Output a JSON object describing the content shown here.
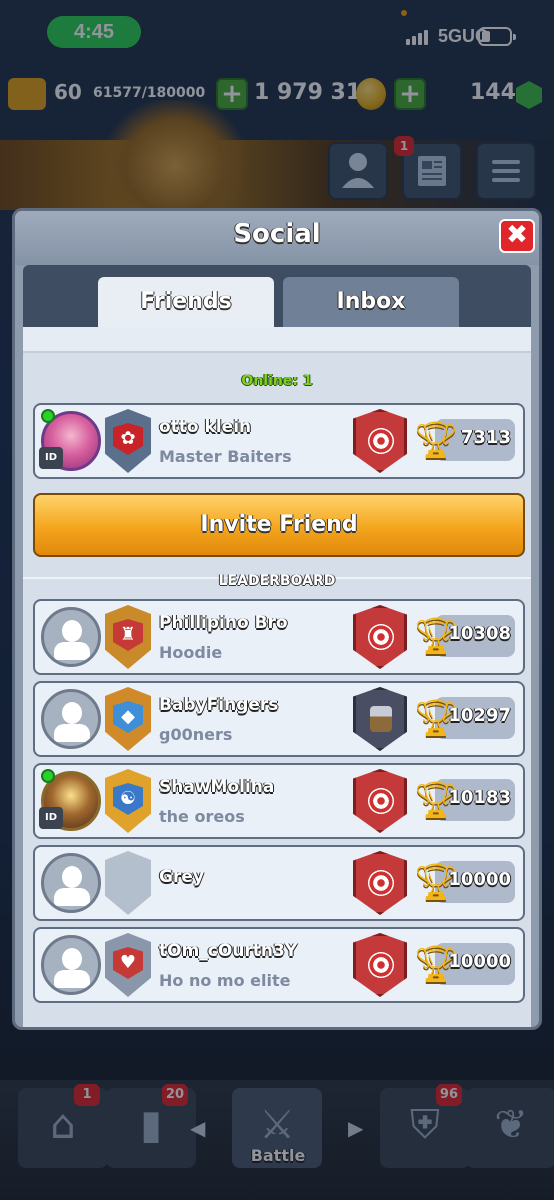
{
  "status_bar": {
    "time": "4:45",
    "network": "5GUC"
  },
  "resources": {
    "level": "60",
    "xp": "61577/180000",
    "gold": "1 979 316",
    "gems": "144",
    "plus": "+"
  },
  "top_buttons": {
    "news_badge": "1"
  },
  "modal": {
    "title": "Social",
    "close_glyph": "✖",
    "tabs": [
      {
        "label": "Friends",
        "selected": true
      },
      {
        "label": "Inbox",
        "selected": false
      }
    ],
    "online_label": "Online: 1",
    "online_friends": [
      {
        "name": "otto klein",
        "clan": "Master Baiters",
        "trophies": "7313",
        "online": true,
        "id_badge": "ID",
        "clan_glyph": "✿",
        "clan_color": "#5a6f8c",
        "clan_inner_color": "#c9232a"
      }
    ],
    "invite_button": "Invite Friend",
    "leaderboard_label": "LEADERBOARD",
    "leaderboard": [
      {
        "name": "Phillipino Bro",
        "clan": "Hoodie",
        "trophies": "10308",
        "online": false,
        "clan_glyph": "♜",
        "clan_color": "#c98a2a",
        "clan_inner_color": "#c53a36",
        "arena": "archer-arena"
      },
      {
        "name": "BabyFingers",
        "clan": "g00ners",
        "trophies": "10297",
        "online": false,
        "clan_glyph": "◆",
        "clan_color": "#d18a2a",
        "clan_inner_color": "#3f8fd8",
        "arena": "hammer-arena"
      },
      {
        "name": "ShawMolina",
        "clan": "the oreos",
        "trophies": "10183",
        "online": true,
        "id_badge": "ID",
        "clan_glyph": "☯",
        "clan_color": "#e0a22a",
        "clan_inner_color": "#3a78c8",
        "arena": "archer-arena"
      },
      {
        "name": "Grey",
        "clan": "",
        "trophies": "10000",
        "online": false,
        "clan_glyph": "",
        "clan_color": "#b4bfcd",
        "clan_inner_color": "#b4bfcd",
        "arena": "archer-arena"
      },
      {
        "name": "tOm_cOurtn3Y",
        "clan": "Ho no mo elite",
        "trophies": "10000",
        "online": false,
        "clan_glyph": "♥",
        "clan_color": "#8a97aa",
        "clan_inner_color": "#c53a36",
        "arena": "archer-arena"
      }
    ]
  },
  "bottom_nav": {
    "shop_badge": "1",
    "cards_badge": "20",
    "battle_label": "Battle",
    "clan_badge": "96"
  },
  "colors": {
    "online_green": "#7ed321",
    "invite_orange": "#f4a51d",
    "close_red": "#e0262a",
    "trophy_gold": "#f2b51a"
  },
  "icons": [
    "person-icon",
    "news-icon",
    "menu-icon",
    "coin-icon",
    "gem-icon",
    "trophy-icon",
    "arena-icon",
    "close-icon",
    "crossed-swords-icon"
  ]
}
